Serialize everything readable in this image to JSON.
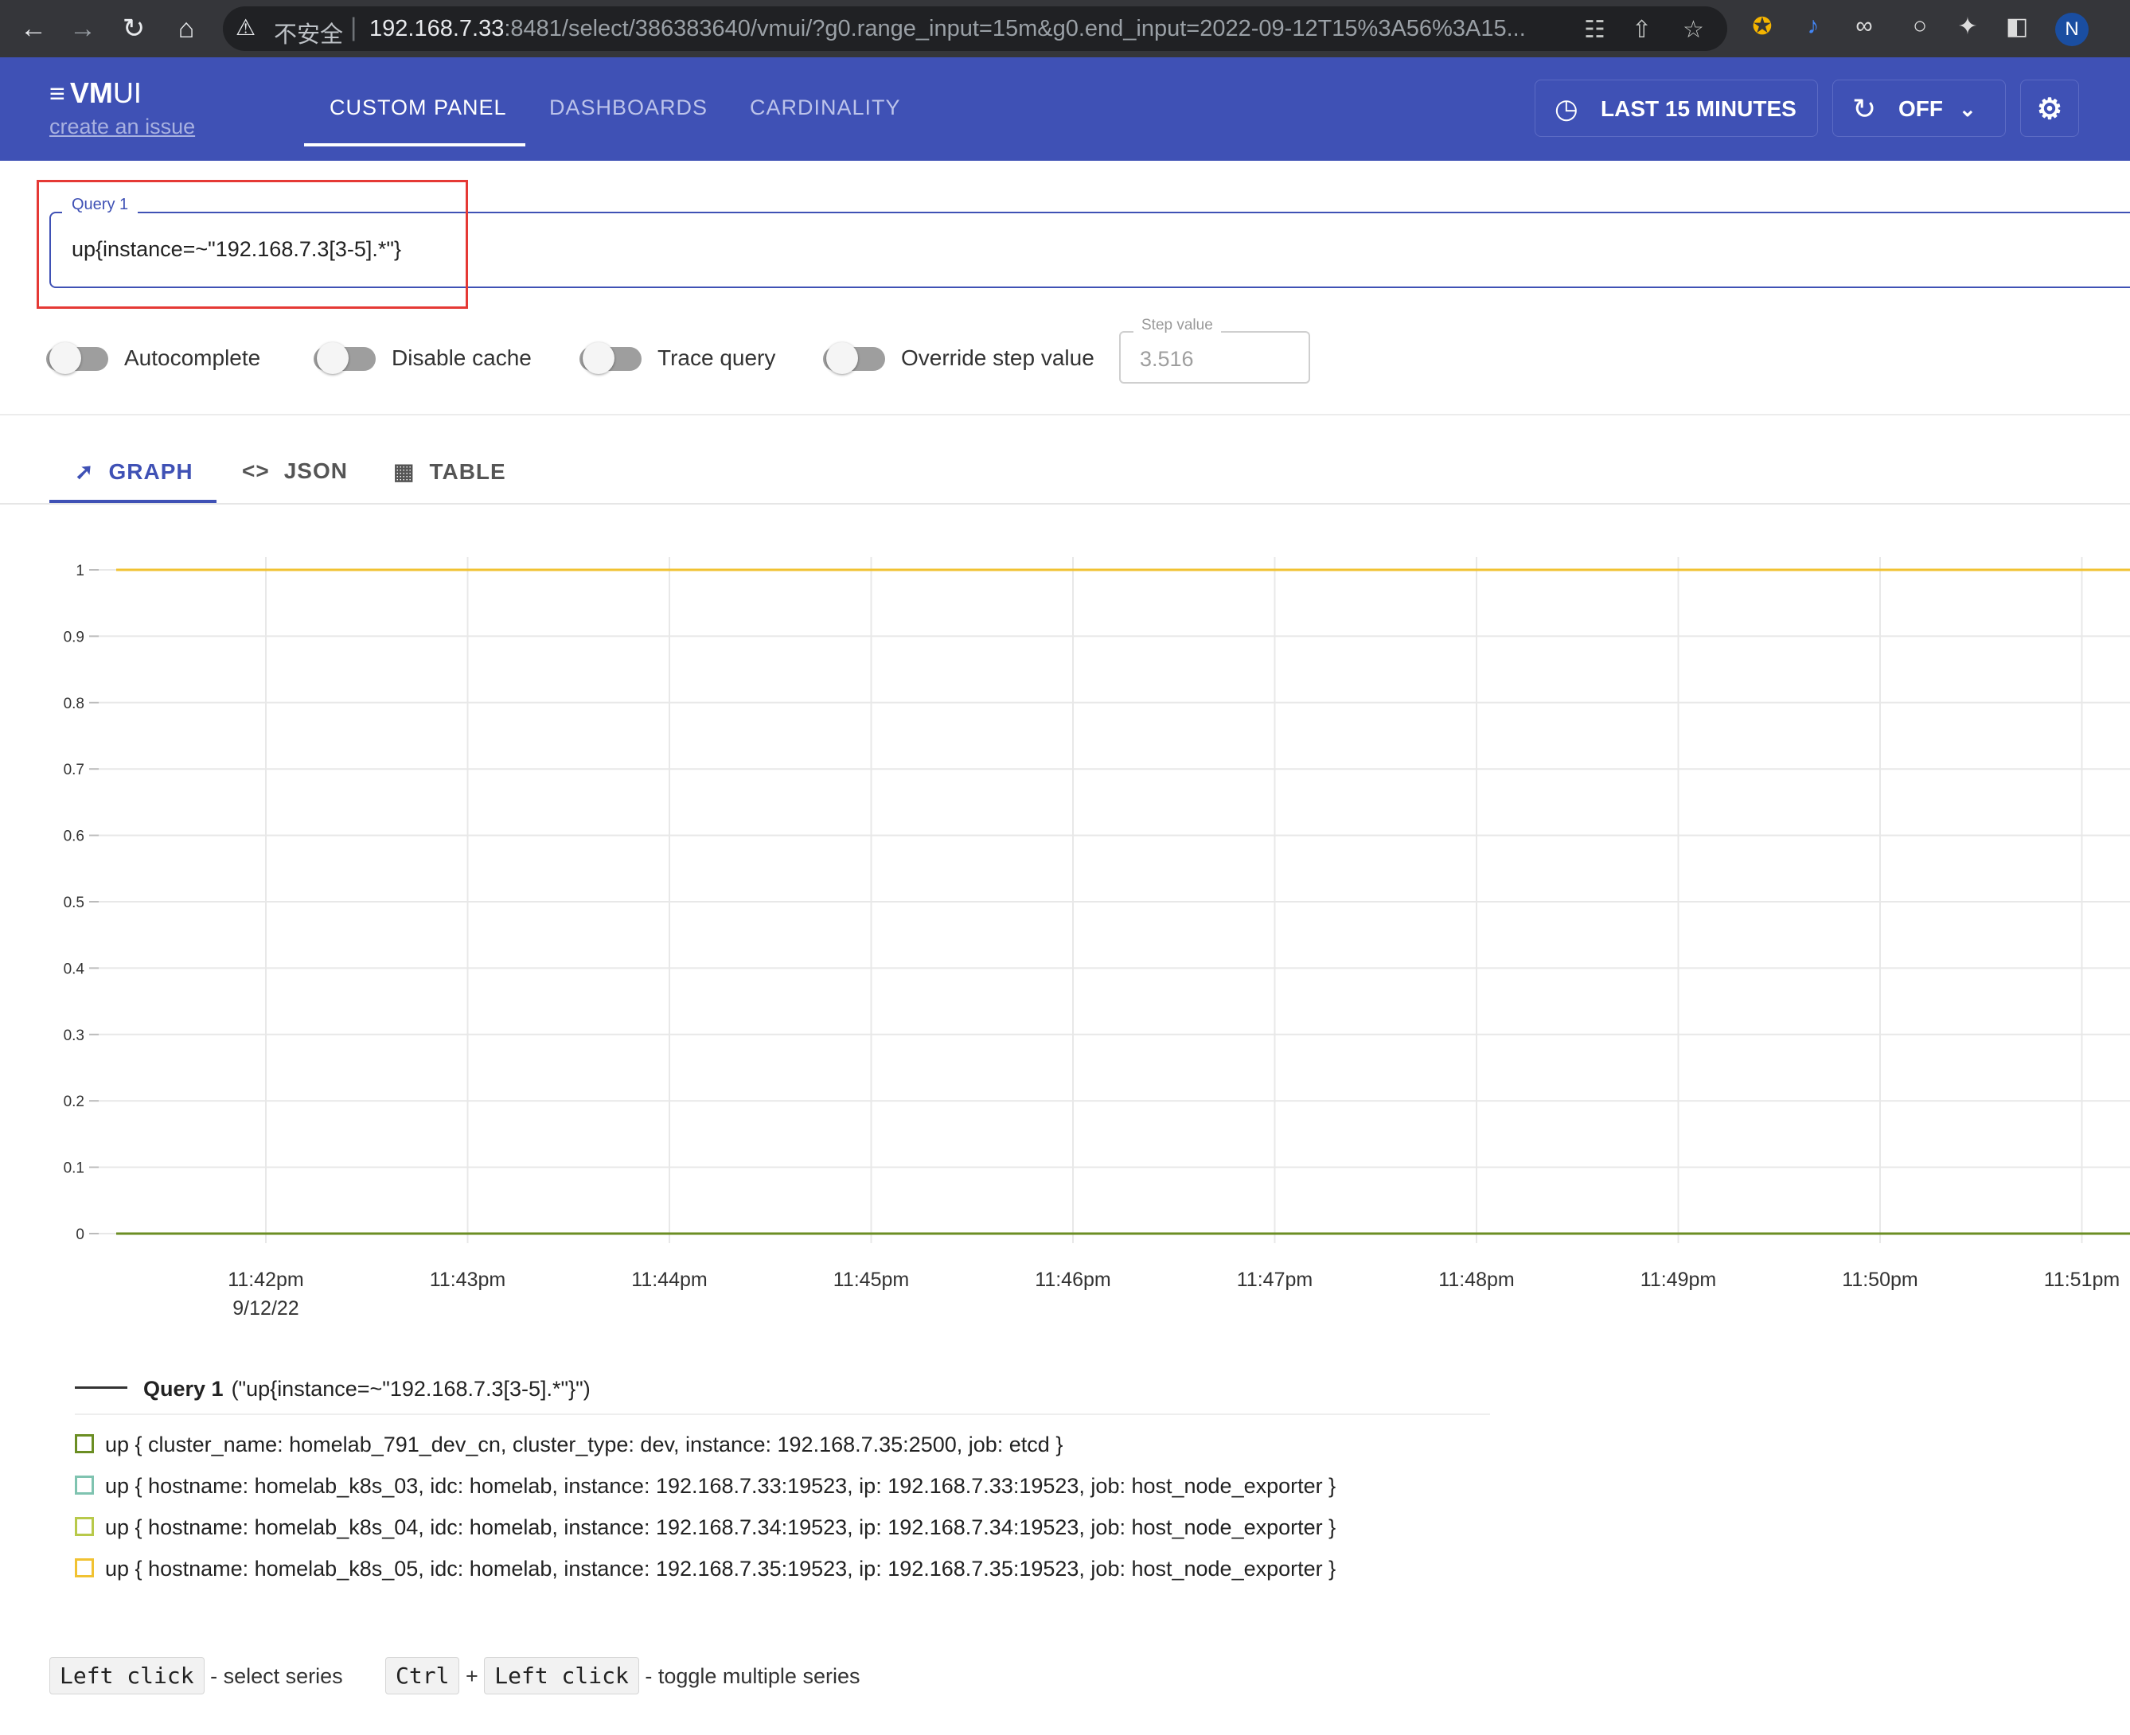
{
  "browser": {
    "insecure_label": "不安全",
    "url_host": "192.168.7.33",
    "url_rest": ":8481/select/386383640/vmui/?g0.range_input=15m&g0.end_input=2022-09-12T15%3A56%3A15...",
    "profile_initial": "N"
  },
  "app": {
    "logo_bold": "VM",
    "logo_light": "UI",
    "issue_link": "create an issue",
    "nav": [
      "CUSTOM PANEL",
      "DASHBOARDS",
      "CARDINALITY"
    ],
    "time_range": "LAST 15 MINUTES",
    "refresh": "OFF"
  },
  "query": {
    "label": "Query 1",
    "value": "up{instance=~\"192.168.7.3[3-5].*\"}"
  },
  "options": {
    "autocomplete": "Autocomplete",
    "disable_cache": "Disable cache",
    "trace_query": "Trace query",
    "override_step": "Override step value",
    "step_label": "Step value",
    "step_value": "3.516"
  },
  "view_tabs": [
    "GRAPH",
    "JSON",
    "TABLE"
  ],
  "chart_data": {
    "type": "line",
    "x": [
      "11:42pm",
      "11:43pm",
      "11:44pm",
      "11:45pm",
      "11:46pm",
      "11:47pm",
      "11:48pm",
      "11:49pm",
      "11:50pm",
      "11:51pm"
    ],
    "x_date": "9/12/22",
    "yticks": [
      "1",
      "0.9",
      "0.8",
      "0.7",
      "0.6",
      "0.5",
      "0.4",
      "0.3",
      "0.2",
      "0.1",
      "0"
    ],
    "ylim": [
      0,
      1
    ],
    "grid": true,
    "series": [
      {
        "color": "#6b8e23",
        "value": 0
      },
      {
        "color": "#7fc3b0",
        "value": 1
      },
      {
        "color": "#b8c94a",
        "value": 1
      },
      {
        "color": "#f1c232",
        "value": 1
      }
    ]
  },
  "legend": {
    "query_label": "Query 1",
    "query_expr": "(\"up{instance=~\"192.168.7.3[3-5].*\"}\")",
    "items": [
      {
        "color": "#6b8e23",
        "text": "up { cluster_name: homelab_791_dev_cn, cluster_type: dev, instance: 192.168.7.35:2500, job: etcd }"
      },
      {
        "color": "#7fc3b0",
        "text": "up { hostname: homelab_k8s_03, idc: homelab, instance: 192.168.7.33:19523, ip: 192.168.7.33:19523, job: host_node_exporter }"
      },
      {
        "color": "#b8c94a",
        "text": "up { hostname: homelab_k8s_04, idc: homelab, instance: 192.168.7.34:19523, ip: 192.168.7.34:19523, job: host_node_exporter }"
      },
      {
        "color": "#f1c232",
        "text": "up { hostname: homelab_k8s_05, idc: homelab, instance: 192.168.7.35:19523, ip: 192.168.7.35:19523, job: host_node_exporter }"
      }
    ]
  },
  "hints": {
    "left_click": "Left click",
    "select_series": "- select series",
    "ctrl": "Ctrl",
    "plus": "+",
    "toggle_multiple": "- toggle multiple series"
  }
}
